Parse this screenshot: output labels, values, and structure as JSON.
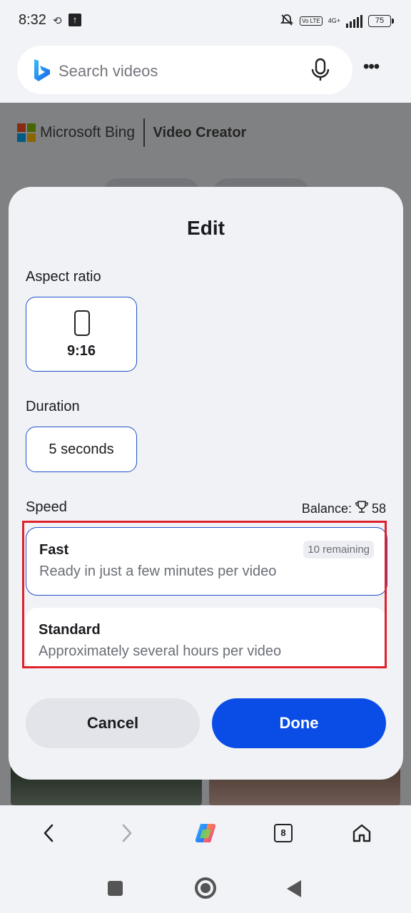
{
  "status_bar": {
    "time": "8:32",
    "network": "4G+",
    "volte": "Vo LTE",
    "battery": "75"
  },
  "browser": {
    "search_placeholder": "Search videos",
    "more_label": "•••"
  },
  "page": {
    "brand": "Microsoft Bing",
    "product": "Video Creator"
  },
  "dialog": {
    "title": "Edit",
    "aspect_label": "Aspect ratio",
    "aspect_value": "9:16",
    "duration_label": "Duration",
    "duration_value": "5 seconds",
    "speed_label": "Speed",
    "balance_label": "Balance:",
    "balance_value": "58",
    "options": [
      {
        "title": "Fast",
        "desc": "Ready in just a few minutes per video",
        "badge": "10 remaining"
      },
      {
        "title": "Standard",
        "desc": "Approximately several hours per video"
      }
    ],
    "cancel_label": "Cancel",
    "done_label": "Done"
  },
  "bottom_nav": {
    "tab_count": "8"
  },
  "colors": {
    "accent": "#0a4de6",
    "highlight": "#e0202b"
  }
}
